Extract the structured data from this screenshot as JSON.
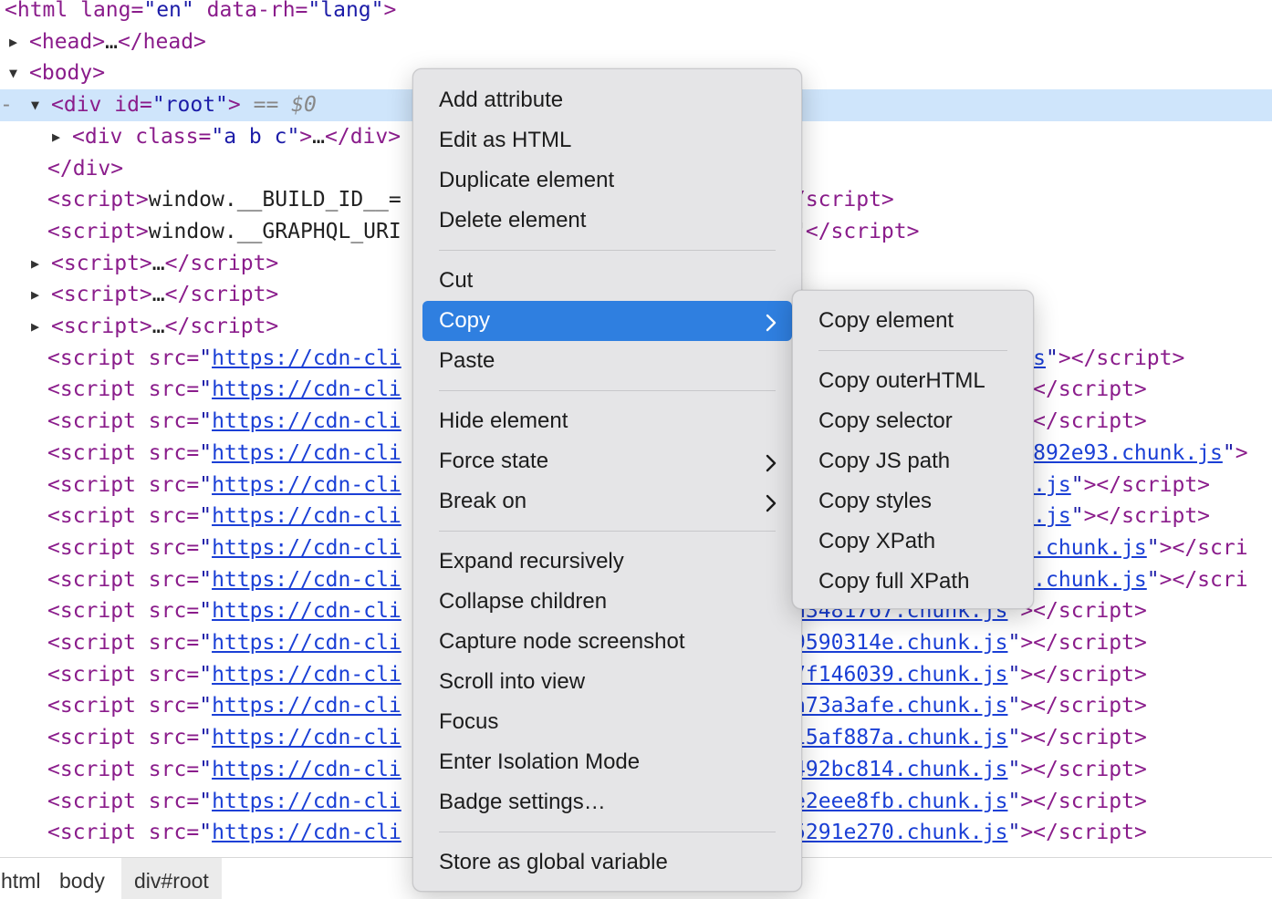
{
  "tree": {
    "lines": [
      {
        "indent": 5,
        "tri": "",
        "html": "<span class=\"tag\">&lt;html</span> <span class=\"an\">lang</span><span class=\"tag\">=</span><span class=\"av\">\"en\"</span> <span class=\"an\">data-rh</span><span class=\"tag\">=</span><span class=\"av\">\"lang\"</span><span class=\"tag\">&gt;</span>"
      },
      {
        "indent": 32,
        "tri": "right",
        "html": "<span class=\"tag\">&lt;head&gt;</span><span class=\"plain\">…</span><span class=\"tag\">&lt;/head&gt;</span>"
      },
      {
        "indent": 32,
        "tri": "down",
        "html": "<span class=\"tag\">&lt;body&gt;</span>"
      },
      {
        "indent": 56,
        "tri": "down",
        "selected": true,
        "html": "<span class=\"tag\">&lt;div</span> <span class=\"an\">id</span><span class=\"tag\">=</span><span class=\"av\">\"root\"</span><span class=\"tag\">&gt;</span> <span class=\"sel-marker\">==</span> <span class=\"dollar\">$0</span>"
      },
      {
        "indent": 79,
        "tri": "right",
        "html": "<span class=\"tag\">&lt;div</span> <span class=\"an\">class</span><span class=\"tag\">=</span><span class=\"av\">\"a b c\"</span><span class=\"tag\">&gt;</span><span class=\"plain\">…</span><span class=\"tag\">&lt;/div&gt;</span>"
      },
      {
        "indent": 52,
        "tri": "",
        "html": "<span class=\"tag\">&lt;/div&gt;</span>"
      },
      {
        "indent": 52,
        "tri": "",
        "html": "<span class=\"tag\">&lt;script&gt;</span><span class=\"plain\">window.__BUILD_ID__=                          4c7\"</span><span class=\"tag\">&lt;/script&gt;</span>"
      },
      {
        "indent": 52,
        "tri": "",
        "html": "<span class=\"tag\">&lt;script&gt;</span><span class=\"plain\">window.__GRAPHQL_URI                          aphql\"</span><span class=\"tag\">&lt;/script&gt;</span>"
      },
      {
        "indent": 56,
        "tri": "right",
        "html": "<span class=\"tag\">&lt;script&gt;</span><span class=\"plain\">…</span><span class=\"tag\">&lt;/script&gt;</span>"
      },
      {
        "indent": 56,
        "tri": "right",
        "html": "<span class=\"tag\">&lt;script&gt;</span><span class=\"plain\">…</span><span class=\"tag\">&lt;/script&gt;</span>"
      },
      {
        "indent": 56,
        "tri": "right",
        "html": "<span class=\"tag\">&lt;script&gt;</span><span class=\"plain\">…</span><span class=\"tag\">&lt;/script&gt;</span>"
      },
      {
        "indent": 52,
        "tri": "",
        "html": "<span class=\"tag\">&lt;script</span> <span class=\"an\">src</span><span class=\"tag\">=</span><span class=\"av\">\"</span><span class=\"lnk\">https://cdn-cli</span>                                                <span class=\"lnk\">.js</span><span class=\"av\">\"</span><span class=\"tag\">&gt;&lt;/script&gt;</span>"
      },
      {
        "indent": 52,
        "tri": "",
        "html": "<span class=\"tag\">&lt;script</span> <span class=\"an\">src</span><span class=\"tag\">=</span><span class=\"av\">\"</span><span class=\"lnk\">https://cdn-cli</span>                                                <span class=\"av\">\"</span><span class=\"tag\">&gt;&lt;/script&gt;</span>"
      },
      {
        "indent": 52,
        "tri": "",
        "html": "<span class=\"tag\">&lt;script</span> <span class=\"an\">src</span><span class=\"tag\">=</span><span class=\"av\">\"</span><span class=\"lnk\">https://cdn-cli</span>                                                <span class=\"av\">\"</span><span class=\"tag\">&gt;&lt;/script&gt;</span>"
      },
      {
        "indent": 52,
        "tri": "",
        "html": "<span class=\"tag\">&lt;script</span> <span class=\"an\">src</span><span class=\"tag\">=</span><span class=\"av\">\"</span><span class=\"lnk\">https://cdn-cli</span>                                                <span class=\"lnk\">14892e93.chunk.js</span><span class=\"av\">\"</span><span class=\"tag\">&gt;</span>"
      },
      {
        "indent": 52,
        "tri": "",
        "html": "<span class=\"tag\">&lt;script</span> <span class=\"an\">src</span><span class=\"tag\">=</span><span class=\"av\">\"</span><span class=\"lnk\">https://cdn-cli</span>                                                <span class=\"lnk\">nk.js</span><span class=\"av\">\"</span><span class=\"tag\">&gt;&lt;/script&gt;</span>"
      },
      {
        "indent": 52,
        "tri": "",
        "html": "<span class=\"tag\">&lt;script</span> <span class=\"an\">src</span><span class=\"tag\">=</span><span class=\"av\">\"</span><span class=\"lnk\">https://cdn-cli</span>                                                <span class=\"lnk\">nk.js</span><span class=\"av\">\"</span><span class=\"tag\">&gt;&lt;/script&gt;</span>"
      },
      {
        "indent": 52,
        "tri": "",
        "html": "<span class=\"tag\">&lt;script</span> <span class=\"an\">src</span><span class=\"tag\">=</span><span class=\"av\">\"</span><span class=\"lnk\">https://cdn-cli</span>                                                <span class=\"lnk\">F5.chunk.js</span><span class=\"av\">\"</span><span class=\"tag\">&gt;&lt;/scri</span>"
      },
      {
        "indent": 52,
        "tri": "",
        "html": "<span class=\"tag\">&lt;script</span> <span class=\"an\">src</span><span class=\"tag\">=</span><span class=\"av\">\"</span><span class=\"lnk\">https://cdn-cli</span>                                                <span class=\"lnk\">0d.chunk.js</span><span class=\"av\">\"</span><span class=\"tag\">&gt;&lt;/scri</span>"
      },
      {
        "indent": 52,
        "tri": "",
        "html": "<span class=\"tag\">&lt;script</span> <span class=\"an\">src</span><span class=\"tag\">=</span><span class=\"av\">\"</span><span class=\"lnk\">https://cdn-cli</span>                         <span class=\"lnk\">/1732.a3481767.chunk.js</span><span class=\"av\">\"</span><span class=\"tag\">&gt;&lt;/script&gt;</span>"
      },
      {
        "indent": 52,
        "tri": "",
        "html": "<span class=\"tag\">&lt;script</span> <span class=\"an\">src</span><span class=\"tag\">=</span><span class=\"av\">\"</span><span class=\"lnk\">https://cdn-cli</span>                         <span class=\"lnk\">/7794.9590314e.chunk.js</span><span class=\"av\">\"</span><span class=\"tag\">&gt;&lt;/script&gt;</span>"
      },
      {
        "indent": 52,
        "tri": "",
        "html": "<span class=\"tag\">&lt;script</span> <span class=\"an\">src</span><span class=\"tag\">=</span><span class=\"av\">\"</span><span class=\"lnk\">https://cdn-cli</span>                         <span class=\"lnk\">/5221.7f146039.chunk.js</span><span class=\"av\">\"</span><span class=\"tag\">&gt;&lt;/script&gt;</span>"
      },
      {
        "indent": 52,
        "tri": "",
        "html": "<span class=\"tag\">&lt;script</span> <span class=\"an\">src</span><span class=\"tag\">=</span><span class=\"av\">\"</span><span class=\"lnk\">https://cdn-cli</span>                         <span class=\"lnk\">/2981.a73a3afe.chunk.js</span><span class=\"av\">\"</span><span class=\"tag\">&gt;&lt;/script&gt;</span>"
      },
      {
        "indent": 52,
        "tri": "",
        "html": "<span class=\"tag\">&lt;script</span> <span class=\"an\">src</span><span class=\"tag\">=</span><span class=\"av\">\"</span><span class=\"lnk\">https://cdn-cli</span>                         <span class=\"lnk\">/4869.15af887a.chunk.js</span><span class=\"av\">\"</span><span class=\"tag\">&gt;&lt;/script&gt;</span>"
      },
      {
        "indent": 52,
        "tri": "",
        "html": "<span class=\"tag\">&lt;script</span> <span class=\"an\">src</span><span class=\"tag\">=</span><span class=\"av\">\"</span><span class=\"lnk\">https://cdn-cli</span>                         <span class=\"lnk\">/9401.492bc814.chunk.js</span><span class=\"av\">\"</span><span class=\"tag\">&gt;&lt;/script&gt;</span>"
      },
      {
        "indent": 52,
        "tri": "",
        "html": "<span class=\"tag\">&lt;script</span> <span class=\"an\">src</span><span class=\"tag\">=</span><span class=\"av\">\"</span><span class=\"lnk\">https://cdn-cli</span>                         <span class=\"lnk\">/2307.e2eee8fb.chunk.js</span><span class=\"av\">\"</span><span class=\"tag\">&gt;&lt;/script&gt;</span>"
      },
      {
        "indent": 52,
        "tri": "",
        "html": "<span class=\"tag\">&lt;script</span> <span class=\"an\">src</span><span class=\"tag\">=</span><span class=\"av\">\"</span><span class=\"lnk\">https://cdn-cli</span>                         <span class=\"lnk\">/9442.5291e270.chunk.js</span><span class=\"av\">\"</span><span class=\"tag\">&gt;&lt;/script&gt;</span>"
      }
    ]
  },
  "breadcrumb": {
    "items": [
      {
        "label": "html",
        "active": false
      },
      {
        "label": "body",
        "active": false
      },
      {
        "label": "div#root",
        "active": true
      }
    ]
  },
  "context_menu": {
    "groups": [
      [
        "Add attribute",
        "Edit as HTML",
        "Duplicate element",
        "Delete element"
      ],
      [
        "Cut",
        "Copy",
        "Paste"
      ],
      [
        "Hide element",
        "Force state",
        "Break on"
      ],
      [
        "Expand recursively",
        "Collapse children",
        "Capture node screenshot",
        "Scroll into view",
        "Focus",
        "Enter Isolation Mode",
        "Badge settings…"
      ],
      [
        "Store as global variable"
      ]
    ],
    "submenu_items": [
      "Copy",
      "Force state",
      "Break on"
    ],
    "highlighted": "Copy"
  },
  "copy_submenu": {
    "groups": [
      [
        "Copy element"
      ],
      [
        "Copy outerHTML",
        "Copy selector",
        "Copy JS path",
        "Copy styles",
        "Copy XPath",
        "Copy full XPath"
      ]
    ]
  },
  "colors": {
    "highlight": "#2f7fe0",
    "selected_row": "#cfe5fb",
    "menu_bg": "#e5e5e7",
    "tag": "#8a1c8b",
    "attr_value": "#1c1ca8",
    "link": "#1a3fd6"
  }
}
